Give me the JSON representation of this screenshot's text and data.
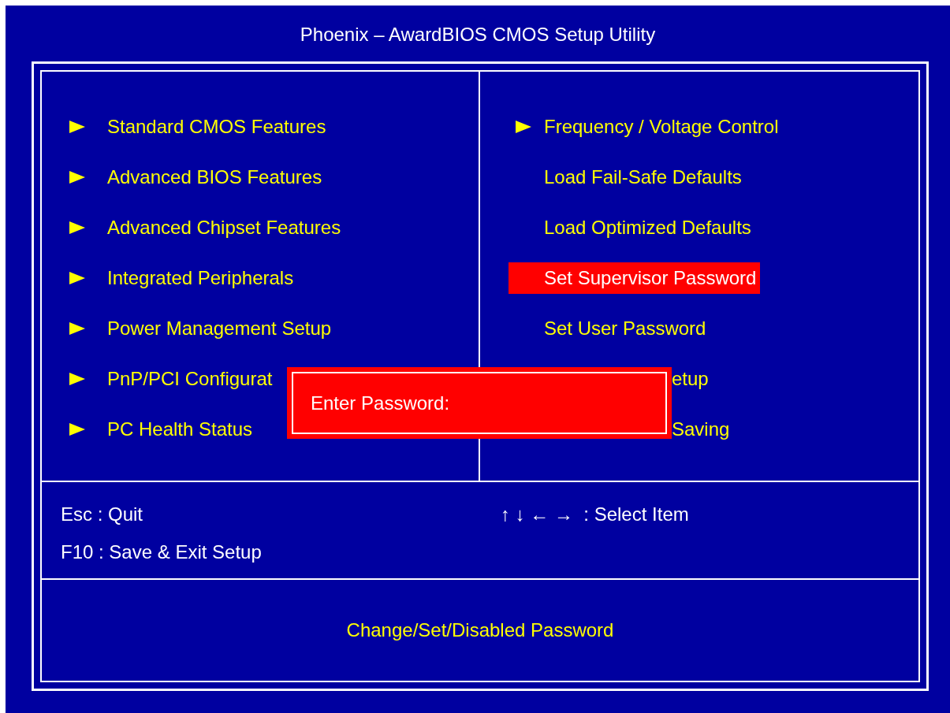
{
  "title": "Phoenix – AwardBIOS CMOS Setup Utility",
  "left_menu": [
    {
      "label": "Standard CMOS Features",
      "kind": "submenu",
      "selected": false
    },
    {
      "label": "Advanced BIOS Features",
      "kind": "submenu",
      "selected": false
    },
    {
      "label": "Advanced Chipset Features",
      "kind": "submenu",
      "selected": false
    },
    {
      "label": "Integrated Peripherals",
      "kind": "submenu",
      "selected": false
    },
    {
      "label": "Power Management Setup",
      "kind": "submenu",
      "selected": false
    },
    {
      "label": "PnP/PCI Configurat",
      "kind": "submenu",
      "selected": false
    },
    {
      "label": "PC Health Status",
      "kind": "submenu",
      "selected": false
    }
  ],
  "right_menu": [
    {
      "label": "Frequency / Voltage Control",
      "kind": "submenu",
      "selected": false
    },
    {
      "label": "Load Fail-Safe Defaults",
      "kind": "action",
      "selected": false
    },
    {
      "label": "Load Optimized Defaults",
      "kind": "action",
      "selected": false
    },
    {
      "label": "Set Supervisor Password",
      "kind": "action",
      "selected": true
    },
    {
      "label": "Set User Password",
      "kind": "action",
      "selected": false
    },
    {
      "label": "etup",
      "kind": "covered",
      "selected": false
    },
    {
      "label": "Saving",
      "kind": "covered",
      "selected": false
    }
  ],
  "keys_left": [
    "Esc : Quit",
    "F10 : Save & Exit Setup"
  ],
  "keys_right": [
    "↑ ↓ ← →  : Select Item"
  ],
  "help": "Change/Set/Disabled Password",
  "dialog": {
    "prompt": "Enter Password:"
  }
}
